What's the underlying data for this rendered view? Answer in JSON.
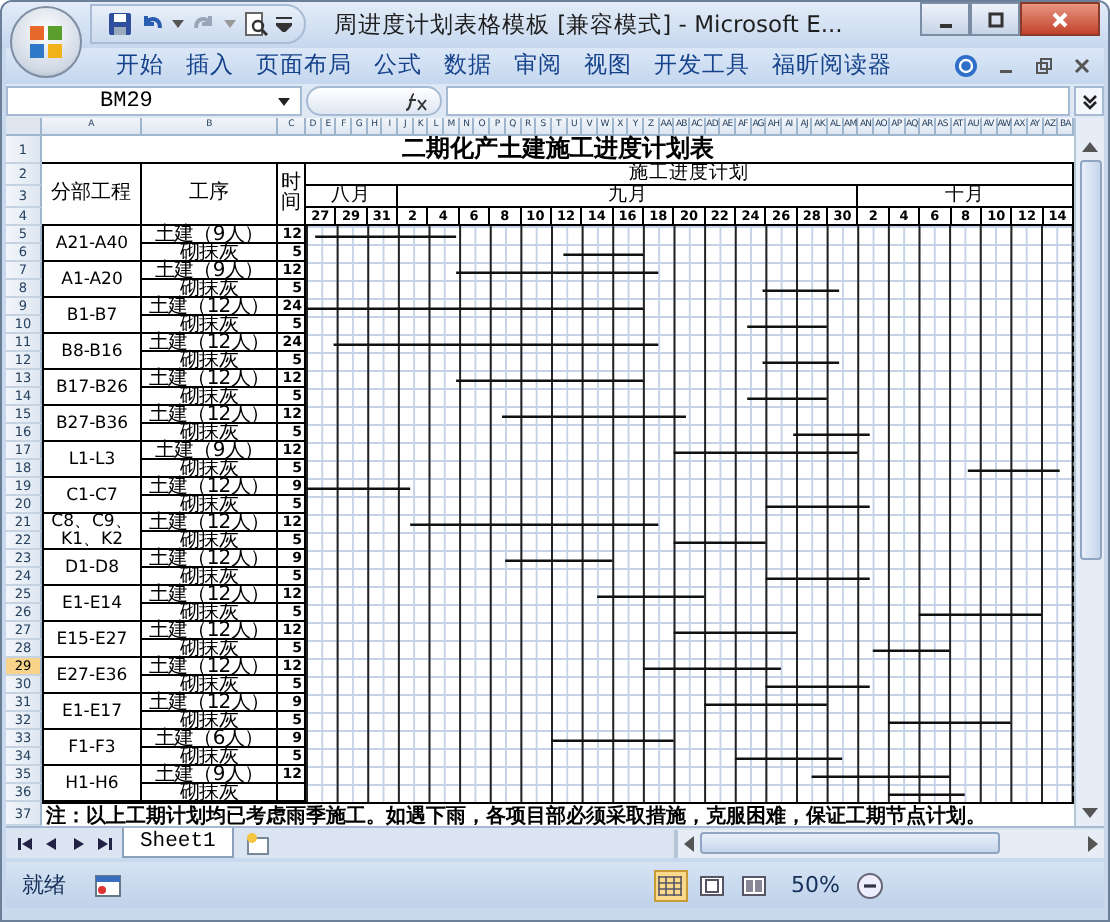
{
  "window": {
    "title": "周进度计划表格模板  [兼容模式] - Microsoft E..."
  },
  "ribbon_tabs": [
    {
      "label": "开始"
    },
    {
      "label": "插入"
    },
    {
      "label": "页面布局"
    },
    {
      "label": "公式"
    },
    {
      "label": "数据"
    },
    {
      "label": "审阅"
    },
    {
      "label": "视图"
    },
    {
      "label": "开发工具"
    },
    {
      "label": "福昕阅读器"
    }
  ],
  "formula_bar": {
    "name_box": "BM29"
  },
  "column_headers": [
    "A",
    "B",
    "C",
    "D",
    "E",
    "F",
    "G",
    "H",
    "I",
    "J",
    "K",
    "L",
    "M",
    "N",
    "O",
    "P",
    "Q",
    "R",
    "S",
    "T",
    "U",
    "V",
    "W",
    "X",
    "Y",
    "Z",
    "AA",
    "AB",
    "AC",
    "AD",
    "AE",
    "AF",
    "AG",
    "AH",
    "AI",
    "AJ",
    "AK",
    "AL",
    "AM",
    "AN",
    "AO",
    "AP",
    "AQ",
    "AR",
    "AS",
    "AT",
    "AU",
    "AV",
    "AW",
    "AX",
    "AY",
    "AZ",
    "BA"
  ],
  "row_numbers": [
    {
      "label": "1",
      "selected": false
    },
    {
      "label": "2",
      "selected": false
    },
    {
      "label": "3",
      "selected": false
    },
    {
      "label": "4",
      "selected": false
    },
    {
      "label": "5",
      "selected": false
    },
    {
      "label": "6",
      "selected": false
    },
    {
      "label": "7",
      "selected": false
    },
    {
      "label": "8",
      "selected": false
    },
    {
      "label": "9",
      "selected": false
    },
    {
      "label": "10",
      "selected": false
    },
    {
      "label": "11",
      "selected": false
    },
    {
      "label": "12",
      "selected": false
    },
    {
      "label": "13",
      "selected": false
    },
    {
      "label": "14",
      "selected": false
    },
    {
      "label": "15",
      "selected": false
    },
    {
      "label": "16",
      "selected": false
    },
    {
      "label": "17",
      "selected": false
    },
    {
      "label": "18",
      "selected": false
    },
    {
      "label": "19",
      "selected": false
    },
    {
      "label": "20",
      "selected": false
    },
    {
      "label": "21",
      "selected": false
    },
    {
      "label": "22",
      "selected": false
    },
    {
      "label": "23",
      "selected": false
    },
    {
      "label": "24",
      "selected": false
    },
    {
      "label": "25",
      "selected": false
    },
    {
      "label": "26",
      "selected": false
    },
    {
      "label": "27",
      "selected": false
    },
    {
      "label": "28",
      "selected": false
    },
    {
      "label": "29",
      "selected": true
    },
    {
      "label": "30",
      "selected": false
    },
    {
      "label": "31",
      "selected": false
    },
    {
      "label": "32",
      "selected": false
    },
    {
      "label": "33",
      "selected": false
    },
    {
      "label": "34",
      "selected": false
    },
    {
      "label": "35",
      "selected": false
    },
    {
      "label": "36",
      "selected": false
    },
    {
      "label": "37",
      "selected": false
    }
  ],
  "sheet": {
    "title": "二期化产土建施工进度计划表",
    "plan_heading": "施工进度计划",
    "headers": {
      "area": "分部工程",
      "process": "工序",
      "time": "时间"
    },
    "months": [
      {
        "label": "八月",
        "dates": [
          "27",
          "29",
          "31"
        ]
      },
      {
        "label": "九月",
        "dates": [
          "2",
          "4",
          "6",
          "8",
          "10",
          "12",
          "14",
          "16",
          "18",
          "20",
          "22",
          "24",
          "26",
          "28",
          "30"
        ]
      },
      {
        "label": "十月",
        "dates": [
          "2",
          "4",
          "6",
          "8",
          "10",
          "12",
          "14"
        ]
      }
    ],
    "areas": [
      {
        "name": "A21-A40",
        "tasks": [
          {
            "process": "土建（9人）",
            "days": "12"
          },
          {
            "process": "砌抹灰",
            "days": "5"
          }
        ]
      },
      {
        "name": "A1-A20",
        "tasks": [
          {
            "process": "土建（9人）",
            "days": "12"
          },
          {
            "process": "砌抹灰",
            "days": "5"
          }
        ]
      },
      {
        "name": "B1-B7",
        "tasks": [
          {
            "process": "土建（12人）",
            "days": "24"
          },
          {
            "process": "砌抹灰",
            "days": "5"
          }
        ]
      },
      {
        "name": "B8-B16",
        "tasks": [
          {
            "process": "土建（12人）",
            "days": "24"
          },
          {
            "process": "砌抹灰",
            "days": "5"
          }
        ]
      },
      {
        "name": "B17-B26",
        "tasks": [
          {
            "process": "土建（12人）",
            "days": "12"
          },
          {
            "process": "砌抹灰",
            "days": "5"
          }
        ]
      },
      {
        "name": "B27-B36",
        "tasks": [
          {
            "process": "土建（12人）",
            "days": "12"
          },
          {
            "process": "砌抹灰",
            "days": "5"
          }
        ]
      },
      {
        "name": "L1-L3",
        "tasks": [
          {
            "process": "土建（9人）",
            "days": "12"
          },
          {
            "process": "砌抹灰",
            "days": "5"
          }
        ]
      },
      {
        "name": "C1-C7",
        "tasks": [
          {
            "process": "土建（12人）",
            "days": "9"
          },
          {
            "process": "砌抹灰",
            "days": "5"
          }
        ]
      },
      {
        "name": "C8、C9、K1、K2",
        "tasks": [
          {
            "process": "土建（12人）",
            "days": "12"
          },
          {
            "process": "砌抹灰",
            "days": "5"
          }
        ]
      },
      {
        "name": "D1-D8",
        "tasks": [
          {
            "process": "土建（12人）",
            "days": "9"
          },
          {
            "process": "砌抹灰",
            "days": "5"
          }
        ]
      },
      {
        "name": "E1-E14",
        "tasks": [
          {
            "process": "土建（12人）",
            "days": "12"
          },
          {
            "process": "砌抹灰",
            "days": "5"
          }
        ]
      },
      {
        "name": "E15-E27",
        "tasks": [
          {
            "process": "土建（12人）",
            "days": "12"
          },
          {
            "process": "砌抹灰",
            "days": "5"
          }
        ]
      },
      {
        "name": "E27-E36",
        "tasks": [
          {
            "process": "土建（12人）",
            "days": "12"
          },
          {
            "process": "砌抹灰",
            "days": "5"
          }
        ]
      },
      {
        "name": "E1-E17",
        "tasks": [
          {
            "process": "土建（12人）",
            "days": "9"
          },
          {
            "process": "砌抹灰",
            "days": "5"
          }
        ]
      },
      {
        "name": "F1-F3",
        "tasks": [
          {
            "process": "土建（6人）",
            "days": "9"
          },
          {
            "process": "砌抹灰",
            "days": "5"
          }
        ]
      },
      {
        "name": "H1-H6",
        "tasks": [
          {
            "process": "土建（9人）",
            "days": "12"
          },
          {
            "process": "砌抹灰"
          }
        ]
      }
    ],
    "note": "注：以上工期计划均已考虑雨季施工。如遇下雨，各项目部必须采取措施，克服困难，保证工期节点计划。"
  },
  "sheet_tabs": [
    {
      "label": "Sheet1",
      "selected": true
    }
  ],
  "status_bar": {
    "status": "就绪",
    "views": [
      {
        "kind": "normal",
        "selected": true
      },
      {
        "kind": "page_layout",
        "selected": false
      },
      {
        "kind": "page_break",
        "selected": false
      }
    ],
    "zoom": "50%"
  }
}
